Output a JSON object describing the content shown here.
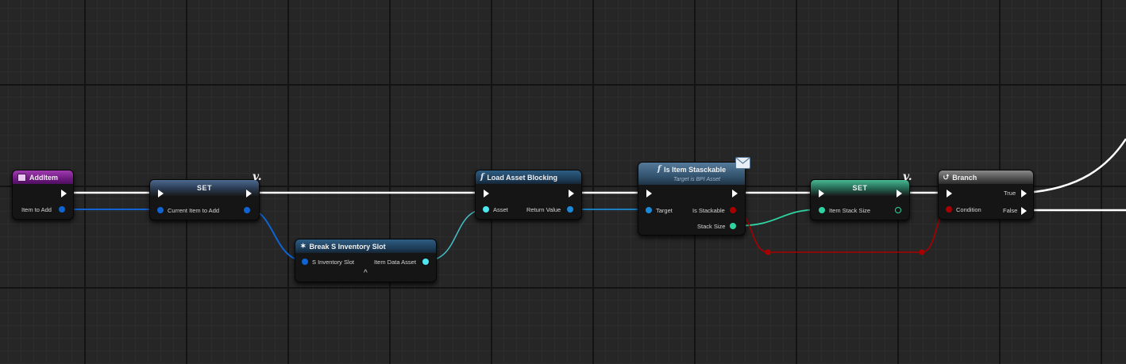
{
  "colors": {
    "exec": "#ffffff",
    "object": "#0f64d2",
    "asset_ref": "#4ee6f0",
    "boolean": "#a80000",
    "integer": "#2fd3a2"
  },
  "nodes": {
    "add_item": {
      "title": "AddItem",
      "icon": "event-icon",
      "pin_item_to_add": "Item to Add"
    },
    "set_current": {
      "title": "SET",
      "pin_current_item_to_add": "Current Item to Add",
      "icon": "variable-icon",
      "icon_glyph": "v."
    },
    "break_slot": {
      "title": "Break S Inventory Slot",
      "icon": "break-struct-icon",
      "pin_s_inventory_slot": "S Inventory Slot",
      "pin_item_data_asset": "Item Data Asset",
      "expand_glyph": "^"
    },
    "load_asset": {
      "title": "Load Asset Blocking",
      "icon": "function-icon",
      "icon_glyph": "f",
      "pin_asset": "Asset",
      "pin_return_value": "Return Value"
    },
    "is_stackable": {
      "title": "Is Item Stasckable",
      "subtitle": "Target is BPI Asset",
      "icon": "function-icon",
      "icon_glyph": "f",
      "message_icon": "interface-message-icon",
      "pin_target": "Target",
      "pin_is_stackable": "Is Stackable",
      "pin_stack_size": "Stack Size"
    },
    "set_stack": {
      "title": "SET",
      "pin_item_stack_size": "Item Stack Size",
      "icon": "variable-icon",
      "icon_glyph": "v."
    },
    "branch": {
      "title": "Branch",
      "icon": "branch-icon",
      "pin_condition": "Condition",
      "pin_true": "True",
      "pin_false": "False"
    }
  }
}
